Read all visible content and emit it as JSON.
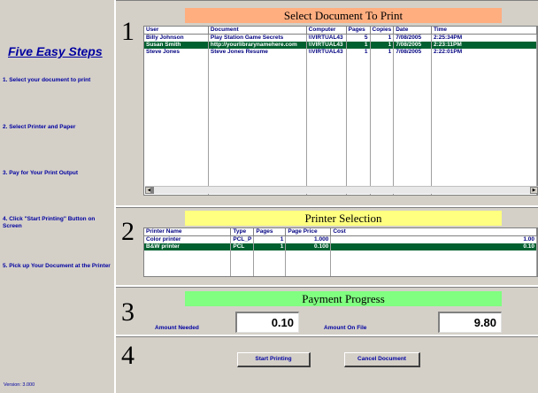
{
  "sidebar": {
    "title": "Five Easy Steps",
    "steps": [
      "1. Select your document to print",
      "2. Select Printer and Paper",
      "3. Pay for Your Print Output",
      "4. Click \"Start Printing\" Button on Screen",
      "5. Pick up Your Document at the Printer"
    ],
    "version": "Version: 3.000"
  },
  "step_numbers": [
    "1",
    "2",
    "3",
    "4"
  ],
  "documents": {
    "title": "Select Document To Print",
    "columns": [
      "User",
      "Document",
      "Computer",
      "Pages",
      "Copies",
      "Date",
      "Time"
    ],
    "rows": [
      {
        "user": "Billy Johnson",
        "document": "Play Station Game Secrets",
        "computer": "\\\\VIRTUAL43",
        "pages": "5",
        "copies": "1",
        "date": "7/08/2005",
        "time": "2:25:34PM",
        "selected": false
      },
      {
        "user": "Susan Smith",
        "document": "http://yourlibrarynamehere.com",
        "computer": "\\\\VIRTUAL43",
        "pages": "1",
        "copies": "1",
        "date": "7/08/2005",
        "time": "2:23:11PM",
        "selected": true
      },
      {
        "user": "Steve Jones",
        "document": "Steve Jones Resume",
        "computer": "\\\\VIRTUAL43",
        "pages": "1",
        "copies": "1",
        "date": "7/08/2005",
        "time": "2:22:01PM",
        "selected": false
      }
    ]
  },
  "printers": {
    "title": "Printer Selection",
    "columns": [
      "Printer Name",
      "Type",
      "Pages",
      "Page Price",
      "Cost"
    ],
    "rows": [
      {
        "name": "Color printer",
        "type": "PCL_P",
        "pages": "1",
        "price": "1.000",
        "cost": "1.00",
        "selected": false
      },
      {
        "name": "B&W printer",
        "type": "PCL",
        "pages": "1",
        "price": "0.100",
        "cost": "0.10",
        "selected": true
      }
    ]
  },
  "payment": {
    "title": "Payment Progress",
    "amount_needed_label": "Amount Needed",
    "amount_needed": "0.10",
    "amount_on_file_label": "Amount On File",
    "amount_on_file": "9.80"
  },
  "actions": {
    "start_label": "Start Printing",
    "cancel_label": "Cancel Document"
  },
  "colors": {
    "header_orange": "#ffae80",
    "header_yellow": "#ffff80",
    "header_green": "#80ff80",
    "selected_row": "#006030",
    "label_blue": "#0000a0"
  }
}
